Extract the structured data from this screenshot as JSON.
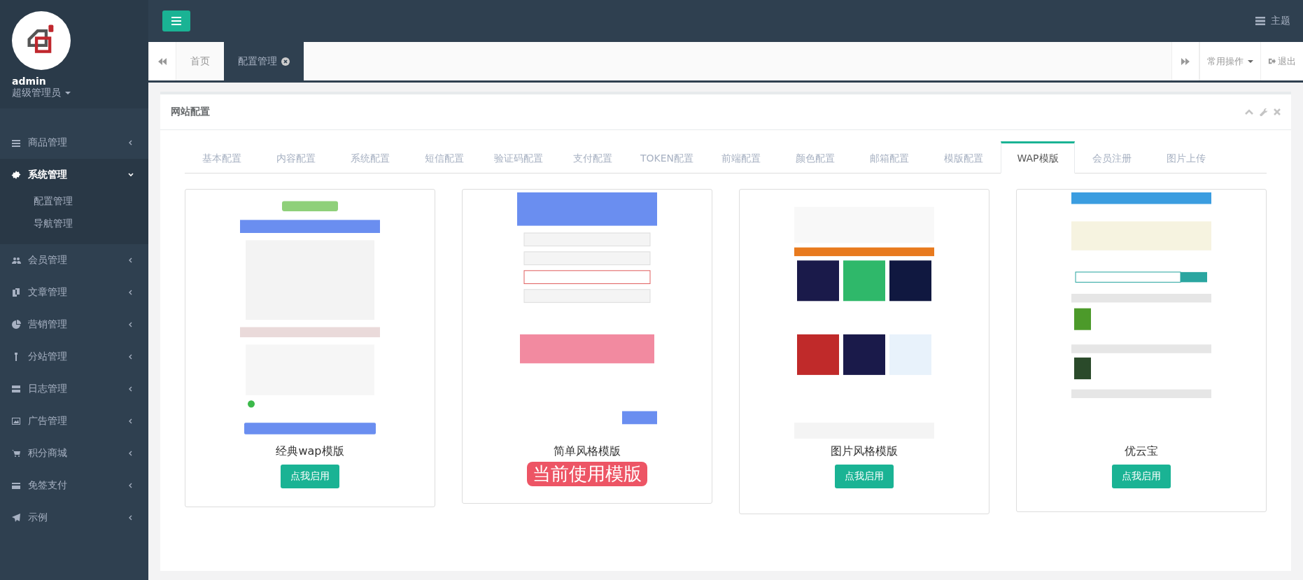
{
  "user": {
    "name": "admin",
    "role": "超级管理员"
  },
  "nav": [
    {
      "label": "商品管理",
      "expanded": false
    },
    {
      "label": "系统管理",
      "expanded": true,
      "children": [
        {
          "label": "配置管理"
        },
        {
          "label": "导航管理"
        }
      ]
    },
    {
      "label": "会员管理",
      "expanded": false
    },
    {
      "label": "文章管理",
      "expanded": false
    },
    {
      "label": "营销管理",
      "expanded": false
    },
    {
      "label": "分站管理",
      "expanded": false
    },
    {
      "label": "日志管理",
      "expanded": false
    },
    {
      "label": "广告管理",
      "expanded": false
    },
    {
      "label": "积分商城",
      "expanded": false
    },
    {
      "label": "免签支付",
      "expanded": false
    },
    {
      "label": "示例",
      "expanded": false
    }
  ],
  "topbar": {
    "theme": "主题"
  },
  "page_tabs": [
    {
      "label": "首页",
      "selected": false,
      "closable": false
    },
    {
      "label": "配置管理",
      "selected": true,
      "closable": true
    }
  ],
  "tab_actions": {
    "menu": "常用操作",
    "logout": "退出"
  },
  "panel": {
    "title": "网站配置"
  },
  "config_tabs": [
    {
      "label": "基本配置",
      "selected": false
    },
    {
      "label": "内容配置",
      "selected": false
    },
    {
      "label": "系统配置",
      "selected": false
    },
    {
      "label": "短信配置",
      "selected": false
    },
    {
      "label": "验证码配置",
      "selected": false
    },
    {
      "label": "支付配置",
      "selected": false
    },
    {
      "label": "TOKEN配置",
      "selected": false
    },
    {
      "label": "前端配置",
      "selected": false
    },
    {
      "label": "颜色配置",
      "selected": false
    },
    {
      "label": "邮箱配置",
      "selected": false
    },
    {
      "label": "模版配置",
      "selected": false
    },
    {
      "label": "WAP模版",
      "selected": true
    },
    {
      "label": "会员注册",
      "selected": false
    },
    {
      "label": "图片上传",
      "selected": false
    }
  ],
  "templates": [
    {
      "name": "经典wap模版",
      "current": false,
      "action": "点我启用"
    },
    {
      "name": "简单风格模版",
      "current": true,
      "action": "当前使用模版"
    },
    {
      "name": "图片风格模版",
      "current": false,
      "action": "点我启用"
    },
    {
      "name": "优云宝",
      "current": false,
      "action": "点我启用"
    }
  ]
}
